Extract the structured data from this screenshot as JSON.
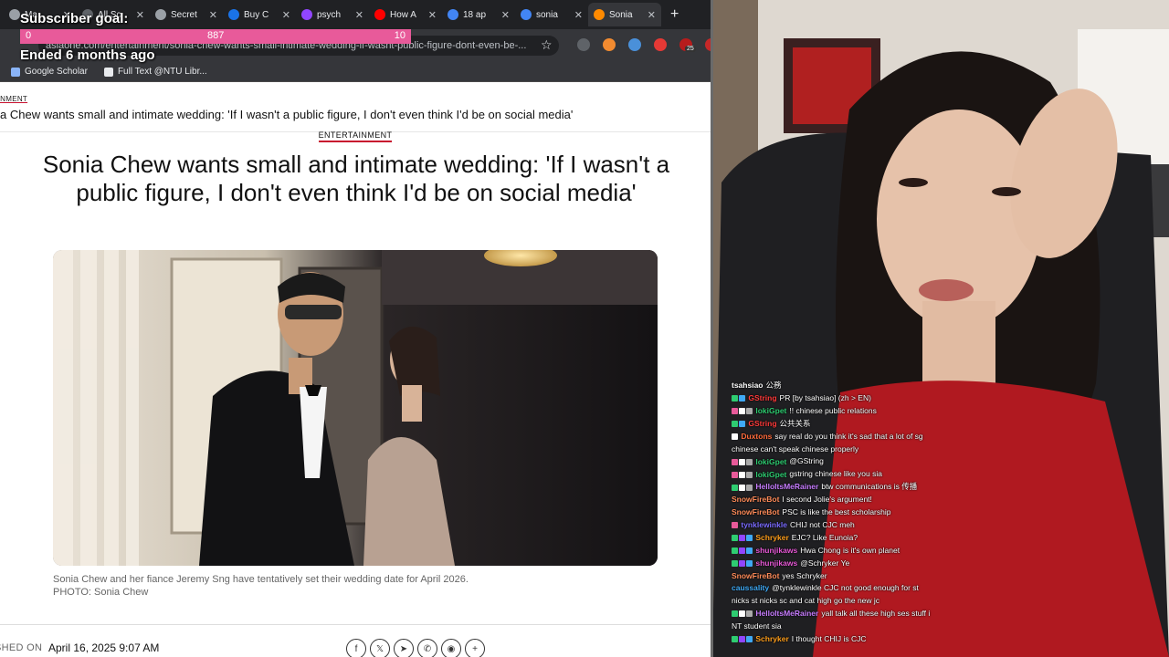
{
  "browser": {
    "tabs": [
      {
        "label": "Ma",
        "icon": "globe-icon",
        "color": "#9aa0a6"
      },
      {
        "label": "All Sc",
        "icon": "globe-icon",
        "color": "#5f6368"
      },
      {
        "label": "Secret",
        "icon": "globe-icon",
        "color": "#9aa0a6"
      },
      {
        "label": "Buy C",
        "icon": "globe-icon",
        "color": "#1a73e8"
      },
      {
        "label": "psych",
        "icon": "twitch-icon",
        "color": "#9146ff"
      },
      {
        "label": "How A",
        "icon": "youtube-icon",
        "color": "#ff0000"
      },
      {
        "label": "18 ap",
        "icon": "google-icon",
        "color": "#4285f4"
      },
      {
        "label": "sonia",
        "icon": "google-icon",
        "color": "#4285f4"
      },
      {
        "label": "Sonia",
        "icon": "straitstimes-icon",
        "color": "#ff8a00"
      }
    ],
    "active_tab": 8,
    "new_tab": "+",
    "url": "asiaone.com/entertainment/sonia-chew-wants-small-intimate-wedding-if-wasnt-public-figure-dont-even-be-...",
    "bookmarks": [
      {
        "label": "Google Scholar",
        "icon": "scholar-icon"
      },
      {
        "label": "Full Text @NTU Libr...",
        "icon": "bookmark-icon"
      }
    ],
    "extension_badge": "25"
  },
  "goal": {
    "title": "Subscriber goal:",
    "min": "0",
    "current": "887",
    "max": "10",
    "status": "Ended 6 months ago"
  },
  "article": {
    "crumb": "AINMENT",
    "sticky_title": "a Chew wants small and intimate wedding: 'If I wasn't a public figure, I don't even think I'd be on social media'",
    "category": "ENTERTAINMENT",
    "headline": "Sonia Chew wants small and intimate wedding: 'If I wasn't a public figure, I don't even think I'd be on social media'",
    "caption_line1": "Sonia Chew and her fiance Jeremy Sng have tentatively set their wedding date for April 2026.",
    "caption_line2": "PHOTO: Sonia Chew",
    "published_label": "SHED ON",
    "published_date": "April 16, 2025 9:07 AM",
    "share_icons": [
      "facebook-icon",
      "x-icon",
      "telegram-icon",
      "whatsapp-icon",
      "reddit-icon",
      "more-icon"
    ],
    "share_glyphs": [
      "f",
      "𝕏",
      "➤",
      "✆",
      "◉",
      "+"
    ]
  },
  "chat": [
    {
      "user": "tsahsiao",
      "color": "#ffffff",
      "text": "公務",
      "badges": []
    },
    {
      "user": "GString",
      "color": "#ff3b3b",
      "text": "PR [by tsahsiao] (zh > EN)",
      "badges": [
        "#2ecc71",
        "#3fa9f5"
      ]
    },
    {
      "user": "lokiGpet",
      "color": "#2ecc71",
      "text": "!! chinese public relations",
      "badges": [
        "#e85a9a",
        "#ffffff",
        "#aaaaaa"
      ]
    },
    {
      "user": "GString",
      "color": "#ff3b3b",
      "text": "公共关系",
      "badges": [
        "#2ecc71",
        "#3fa9f5"
      ]
    },
    {
      "user": "Duxtons",
      "color": "#ff6b3b",
      "text": "say real do you think it's sad that a lot of sg chinese can't speak chinese properly",
      "badges": [
        "#ffffff"
      ]
    },
    {
      "user": "lokiGpet",
      "color": "#2ecc71",
      "text": "@GString",
      "badges": [
        "#e85a9a",
        "#ffffff",
        "#aaaaaa"
      ]
    },
    {
      "user": "lokiGpet",
      "color": "#2ecc71",
      "text": "gstring chinese like you sia",
      "badges": [
        "#e85a9a",
        "#ffffff",
        "#aaaaaa"
      ]
    },
    {
      "user": "HelloItsMeRainer",
      "color": "#c77dff",
      "text": "btw communications is 传播",
      "badges": [
        "#2ecc71",
        "#ffffff",
        "#aaaaaa"
      ]
    },
    {
      "user": "SnowFireBot",
      "color": "#ff8c5a",
      "text": "I second Jolie's argument!",
      "badges": []
    },
    {
      "user": "SnowFireBot",
      "color": "#ff8c5a",
      "text": "PSC is like the best scholarship",
      "badges": []
    },
    {
      "user": "tynklewinkle",
      "color": "#7b6cff",
      "text": "CHIJ not CJC meh",
      "badges": [
        "#e85a9a"
      ]
    },
    {
      "user": "Schryker",
      "color": "#ff9f1c",
      "text": "EJC? Like Eunoia?",
      "badges": [
        "#2ecc71",
        "#9146ff",
        "#3fa9f5"
      ]
    },
    {
      "user": "shunjikaws",
      "color": "#e85ad8",
      "text": "Hwa Chong is it's own planet",
      "badges": [
        "#2ecc71",
        "#9146ff",
        "#3fa9f5"
      ]
    },
    {
      "user": "shunjikaws",
      "color": "#e85ad8",
      "text": "@Schryker Ye",
      "badges": [
        "#2ecc71",
        "#9146ff",
        "#3fa9f5"
      ]
    },
    {
      "user": "SnowFireBot",
      "color": "#ff8c5a",
      "text": "yes Schryker",
      "badges": []
    },
    {
      "user": "caussality",
      "color": "#3fa9f5",
      "text": "@tynklewinkle CJC not good enough for st nicks st nicks sc and cat high go the new jc",
      "badges": []
    },
    {
      "user": "HelloItsMeRainer",
      "color": "#c77dff",
      "text": "yall talk all these high ses stuff i NT student sia",
      "badges": [
        "#2ecc71",
        "#ffffff",
        "#aaaaaa"
      ]
    },
    {
      "user": "Schryker",
      "color": "#ff9f1c",
      "text": "I thought CHIJ is CJC",
      "badges": [
        "#2ecc71",
        "#9146ff",
        "#3fa9f5"
      ]
    }
  ]
}
